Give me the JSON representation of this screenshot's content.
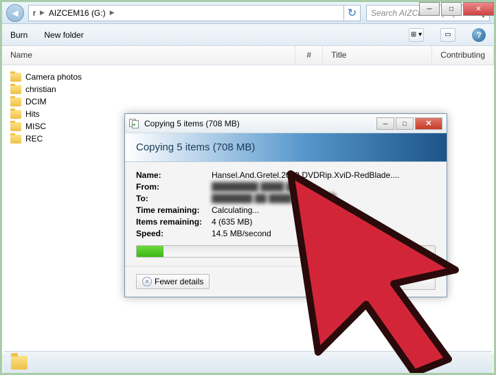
{
  "window": {
    "breadcrumb_prefix": "r",
    "drive_label": "AIZCEM16 (G:)",
    "search_placeholder": "Search AIZCEM16 (G:)"
  },
  "toolbar": {
    "burn": "Burn",
    "new_folder": "New folder"
  },
  "columns": {
    "name": "Name",
    "num": "#",
    "title": "Title",
    "contributing": "Contributing"
  },
  "files": [
    {
      "name": "Camera photos"
    },
    {
      "name": "christian"
    },
    {
      "name": "DCIM"
    },
    {
      "name": "Hits"
    },
    {
      "name": "MISC"
    },
    {
      "name": "REC"
    }
  ],
  "dialog": {
    "title": "Copying 5 items (708 MB)",
    "heading": "Copying 5 items (708 MB)",
    "rows": {
      "name_label": "Name:",
      "name_value": "Hansel.And.Gretel.2013.DVDRip.XviD-RedBlade....",
      "from_label": "From:",
      "from_value": "████████ ████ ██",
      "to_label": "To:",
      "to_value": "███████  ██ ████ ███████",
      "time_label": "Time remaining:",
      "time_value": "Calculating...",
      "items_label": "Items remaining:",
      "items_value": "4 (635 MB)",
      "speed_label": "Speed:",
      "speed_value": "14.5 MB/second"
    },
    "progress_percent": 9,
    "fewer_details": "Fewer details"
  }
}
